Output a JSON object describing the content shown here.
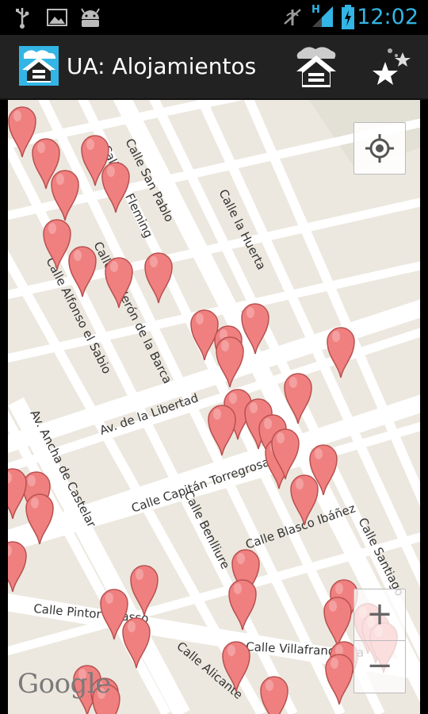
{
  "status_bar": {
    "time": "12:02",
    "network": "H",
    "icons": [
      "usb-icon",
      "image-icon",
      "android-icon",
      "signal-off-icon",
      "signal-strength-icon",
      "battery-charging-icon"
    ]
  },
  "action_bar": {
    "title": "UA: Alojamientos",
    "app_icon": "house-app-icon",
    "actions": [
      {
        "name": "nearby-housing-action",
        "icon": "house-cloud-icon"
      },
      {
        "name": "favorites-action",
        "icon": "stars-icon"
      }
    ]
  },
  "map": {
    "attribution": "Google",
    "controls": {
      "my_location_icon": "crosshair-icon",
      "zoom_in_label": "+",
      "zoom_out_label": "−"
    },
    "street_labels": {
      "calle_san_pablo": "Calle San Pablo",
      "calle_fleming": "Calle Dr. Fleming",
      "calle_la_huerta": "Calle la Huerta",
      "calle_alfonso": "Calle Alfonso el Sabio",
      "calle_calderon": "Calle Calderón de la Barca",
      "av_libertad": "Av. de la Libertad",
      "av_castelar": "Av. Ancha de Castelar",
      "calle_capitan": "Calle Capitán Torregrosa",
      "calle_benlliure": "Calle Benlliure",
      "calle_blasco": "Calle Blasco Ibáñez",
      "calle_santiago": "Calle Santiago",
      "calle_pintor": "Calle Pintor Picasso",
      "calle_alicante": "Calle Alicante",
      "calle_villafranqueza": "Calle Villafranqueza"
    },
    "marker_color": "#f08080",
    "marker_count": 44
  }
}
